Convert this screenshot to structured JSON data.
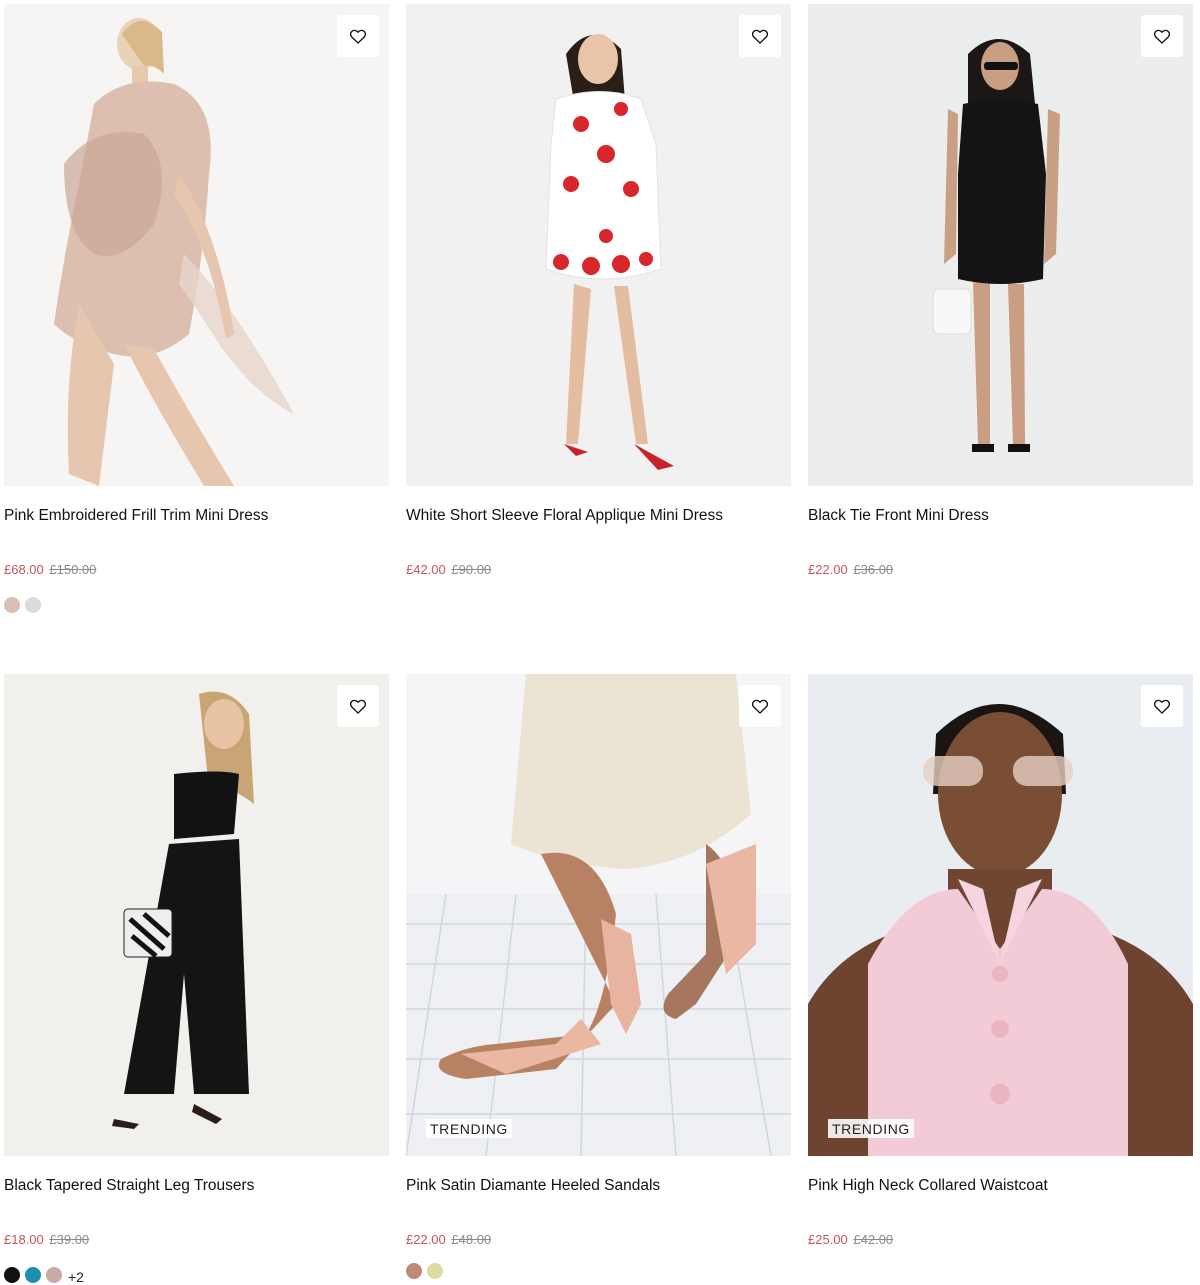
{
  "products": [
    {
      "title": "Pink Embroidered Frill Trim Mini Dress",
      "price": "£68.00",
      "was_price": "£150.00",
      "photo_desc": "model-in-blush-ruffle-dress",
      "swatches": [
        "#d8c0b2",
        "#dcdcdc"
      ],
      "more": ""
    },
    {
      "title": "White Short Sleeve Floral Applique Mini Dress",
      "price": "£42.00",
      "was_price": "£90.00",
      "photo_desc": "model-in-white-floral-dress",
      "swatches": [],
      "more": ""
    },
    {
      "title": "Black Tie Front Mini Dress",
      "price": "£22.00",
      "was_price": "£36.00",
      "photo_desc": "model-in-black-mini-dress",
      "swatches": [],
      "more": ""
    },
    {
      "title": "Black Tapered Straight Leg Trousers",
      "price": "£18.00",
      "was_price": "£39.00",
      "photo_desc": "model-in-black-trousers",
      "swatches": [
        "#111111",
        "#1e8fb0",
        "#c9a9a6"
      ],
      "more": "+2"
    },
    {
      "title": "Pink Satin Diamante Heeled Sandals",
      "price": "£22.00",
      "was_price": "£48.00",
      "badge": "TRENDING",
      "photo_desc": "pink-heeled-sandals-on-tiles",
      "swatches": [
        "#c08a76",
        "#dcdca0"
      ],
      "more": ""
    },
    {
      "title": "Pink High Neck Collared Waistcoat",
      "price": "£25.00",
      "was_price": "£42.00",
      "badge": "TRENDING",
      "photo_desc": "model-in-pink-waistcoat",
      "swatches": [],
      "more": ""
    }
  ],
  "colors": {
    "sale_price": "#c8555a",
    "was_price": "#8a8a8a"
  },
  "icons": {
    "wishlist": "heart-outline-icon"
  }
}
